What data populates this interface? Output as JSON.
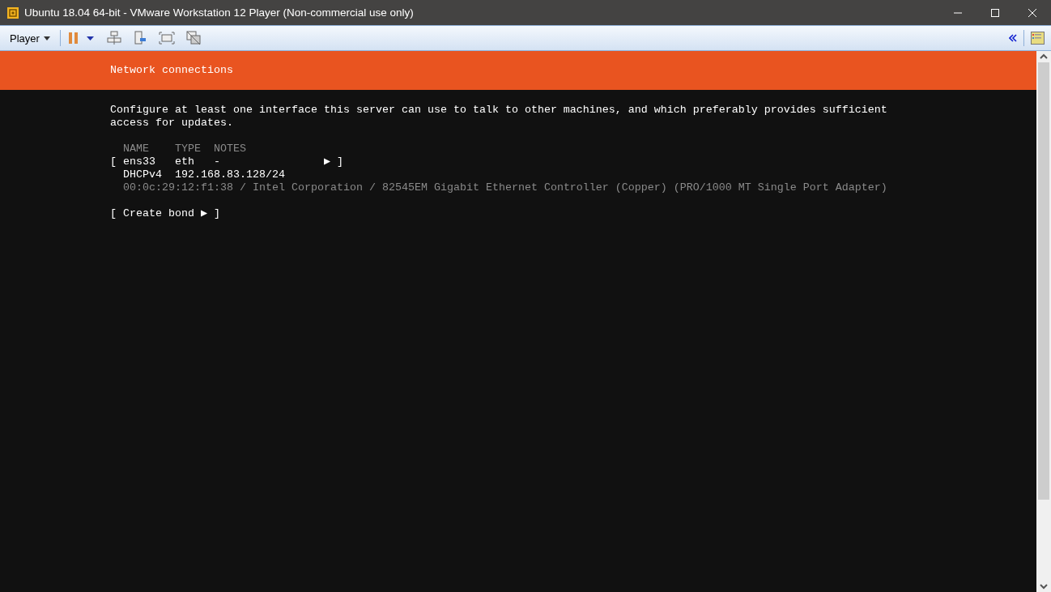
{
  "window": {
    "title": "Ubuntu 18.04 64-bit - VMware Workstation 12 Player (Non-commercial use only)"
  },
  "toolbar": {
    "menu": "Player"
  },
  "header": {
    "title": "Network connections"
  },
  "intro": "Configure at least one interface this server can use to talk to other machines, and which preferably provides sufficient access for updates.",
  "table": {
    "columns": [
      "NAME",
      "TYPE",
      "NOTES"
    ],
    "rows": [
      {
        "open": "[",
        "name": "ens33",
        "type": "eth",
        "notes": "-",
        "arrow": "▶",
        "close": "]",
        "method": "DHCPv4",
        "address": "192.168.83.128/24",
        "details": "00:0c:29:12:f1:38 / Intel Corporation / 82545EM Gigabit Ethernet Controller (Copper) (PRO/1000 MT Single Port Adapter)"
      }
    ]
  },
  "create_bond": "[ Create bond ▶ ]"
}
